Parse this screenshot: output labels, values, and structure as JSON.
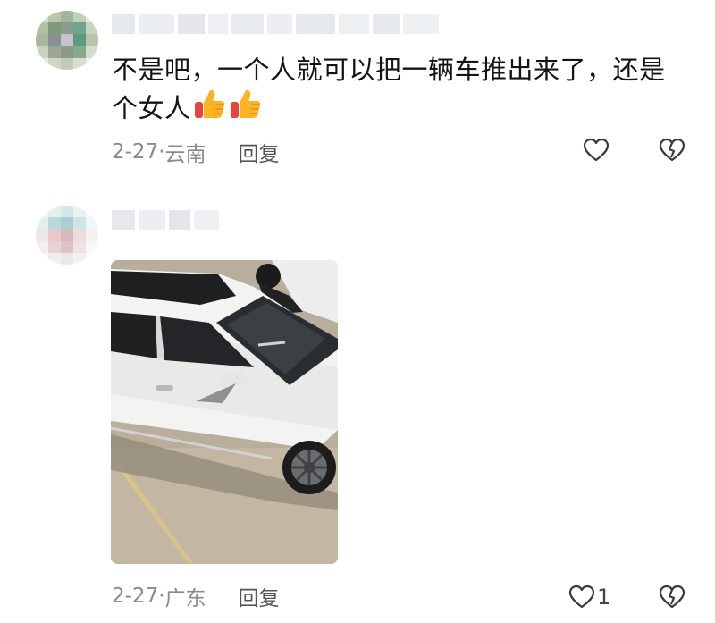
{
  "comments": [
    {
      "text": "不是吧，一个人就可以把一辆车推出来了，还是个女人",
      "emoji": "thumbs-up-icon x2",
      "date": "2-27",
      "separator": "·",
      "location": "云南",
      "reply_label": "回复",
      "likes": ""
    },
    {
      "text": "",
      "image": "photo of white sedan",
      "date": "2-27",
      "separator": "·",
      "location": "广东",
      "reply_label": "回复",
      "likes": "1"
    }
  ],
  "colors": {
    "meta_text": "#8a8a8a",
    "reply_text": "#555555",
    "icon_stroke": "#3a3a3a"
  }
}
